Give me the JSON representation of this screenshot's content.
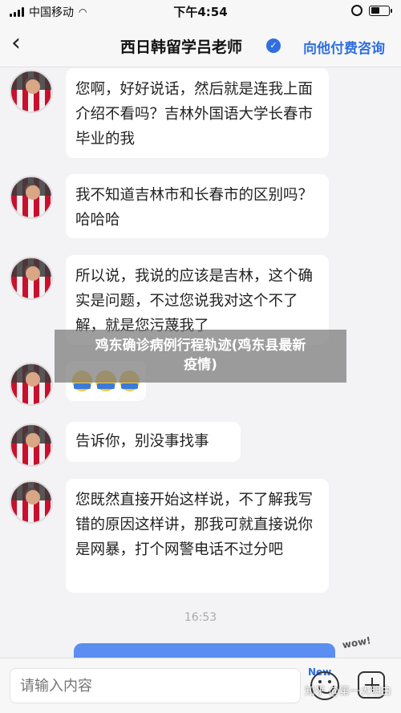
{
  "status_bar": {
    "carrier": "中国移动",
    "time": "下午4:54"
  },
  "nav": {
    "back_icon": "chevron-left-icon",
    "title": "西日韩留学吕老师",
    "verified_icon": "verified-check-icon",
    "action_label": "向他付费咨询"
  },
  "messages": [
    {
      "text": "您啊，好好说话，然后就是连我上面介绍不看吗？吉林外国语大学长春市毕业的我"
    },
    {
      "text": "我不知道吉林市和长春市的区别吗？哈哈哈"
    },
    {
      "text": "所以说，我说的应该是吉林，这个确实是问题，不过您说我对这个不了解，就是您污蔑我了"
    },
    {
      "emoji_text": "赞同"
    },
    {
      "text": "告诉你，别没事找事"
    },
    {
      "text": "您既然直接开始这样说，不了解我写错的原因这样讲，那我可就直接说你是网暴，打个网警电话不过分吧"
    }
  ],
  "timestamp": "16:53",
  "sticker_text": "wow!",
  "banner": {
    "line1": "鸡东确诊病例行程轨迹(鸡东县最新",
    "line2": "疫情)"
  },
  "input": {
    "placeholder": "请输入内容",
    "new_badge": "New",
    "watermark": "知乎 @第一大明白"
  },
  "colors": {
    "accent": "#2f6fe0",
    "bubble": "#ffffff",
    "background": "#f3f3f6"
  }
}
